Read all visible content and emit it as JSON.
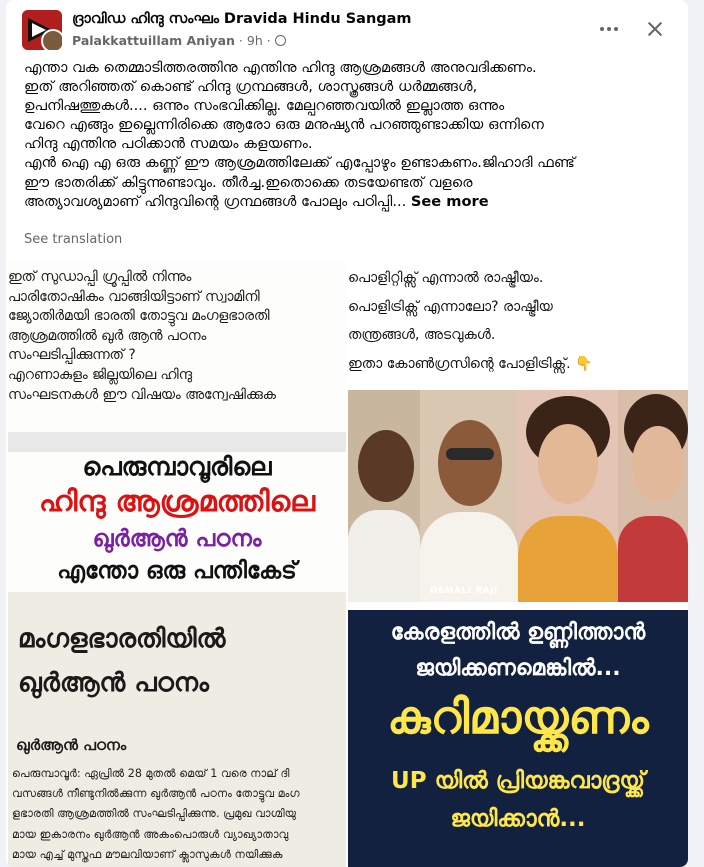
{
  "post": {
    "group_name": "ദ്രാവിഡ ഹിന്ദു സംഘം Dravida Hindu Sangam",
    "author": "Palakkattuillam Aniyan",
    "time": "9h",
    "text": "എന്താ വക തെമ്മാടിത്തരത്തിനു എന്തിനു ഹിന്ദു ആശ്രമങ്ങൾ അനുവദിക്കണം.\nഇത് അറിഞ്ഞത് കൊണ്ട് ഹിന്ദു ഗ്രന്ഥങ്ങൾ, ശാസ്ത്രങ്ങൾ ധർമ്മങ്ങൾ,\nഉപനിഷത്തുകൾ.... ഒന്നും സംഭവിക്കില്ല. മേല്പറഞ്ഞവയിൽ ഇല്ലാത്ത ഒന്നും\nവേറെ എങ്ങും ഇല്ലെന്നിരിക്കെ ആരോ ഒരു മനുഷ്യൻ പറഞ്ഞുണ്ടാക്കിയ ഒന്നിനെ\nഹിന്ദു എന്തിനു പഠിക്കാൻ സമയം കളയണം.\nഎൻ ഐ എ ഒരു കണ്ണ് ഈ ആശ്രമത്തിലേക്ക് എപ്പോഴും ഉണ്ടാകണം.ജിഹാദി ഫണ്ട്\nഈ ഭാതരിക്ക് കിട്ടുന്നുണ്ടാവും. തീർച്ച.ഇതൊക്കെ തടയേണ്ടത് വളരെ\nഅത്യാവശ്യമാണ് ഹിന്ദുവിന്റെ ഗ്രന്ഥങ്ങൾ പോലും പഠിപ്പി...",
    "see_more": "See more",
    "see_translation": "See translation"
  },
  "images": {
    "left": {
      "lines": [
        "ഇത് സുഡാപ്പി ഗ്രൂപ്പിൽ നിന്നും",
        "പാരിതോഷികം വാങ്ങിയിട്ടാണ് സ്വാമിനി",
        "ജ്യോതിർമയി ഭാരതി തോട്ടുവ മംഗളഭാരതി",
        "ആശ്രമത്തിൽ ഖുർ ആൻ പഠനം",
        "സംഘടിപ്പിക്കുന്നത് ?",
        "എറണാകുളം ജില്ലയിലെ ഹിന്ദു",
        "സംഘടനകൾ ഈ വിഷയം അന്വേഷിക്കുക"
      ],
      "headline1": "പെരുമ്പാവൂരിലെ",
      "headline2": "ഹിന്ദു ആശ്രമത്തിലെ",
      "headline3": "ഖുർആൻ പഠനം",
      "headline4": "എന്തോ ഒരു പന്തികേട്",
      "clip_title1": "മംഗളഭാരതിയിൽ",
      "clip_title2": "ഖുർആൻ പഠനം",
      "clip_subtitle": "ഖുർആൻ പഠനം",
      "clip_body": [
        "പെരുമ്പാവൂർ: ഏപ്രിൽ 28 മുതൽ മെയ് 1 വരെ നാല് ദി",
        "വസങ്ങൾ നീണ്ടുനിൽക്കുന്ന ഖുർആൻ പഠനം തോട്ടുവ മംഗ",
        "ളഭാരതി ആശ്രമത്തിൽ സംഘടിപ്പിക്കുന്നു. പ്രമുഖ വാഗ്മിയു",
        "മായ ഇകാരനം ഖുർആൻ അകംപൊരുൾ വ്യാഖ്യാതാവു",
        "മായ എച്ച് മുസ്തഫ മൗലവിയാണ് ക്ലാസുകൾ നയിക്കുക"
      ]
    },
    "top_right": {
      "lines": [
        "പൊളിറ്റിക്സ് എന്നാൽ രാഷ്ട്രീയം.",
        "പൊളിട്രിക്സ് എന്നാലോ? രാഷ്ട്രീയ",
        "തന്ത്രങ്ങൾ, അടവുകൾ.",
        "ഇതാ കോൺഗ്രസിന്റെ പോളിട്രിക്സ്. 👇"
      ],
      "credit": "DEMALI RAJI"
    },
    "bottom_right": {
      "line1": "കേരളത്തിൽ ഉണ്ണിത്താൻ",
      "line2": "ജയിക്കണമെങ്കിൽ...",
      "big": "കുറിമായ്ക്കണം",
      "line3": "UP യിൽ പ്രിയങ്കവാദ്രയ്ക്ക്",
      "line4": "ജയിക്കാൻ..."
    }
  },
  "colors": {
    "brand_red": "#b11e1e",
    "headline_red": "#dd1111",
    "headline_purple": "#7a1fa6",
    "banner_navy": "#12213f",
    "banner_yellow": "#ffe74a"
  }
}
